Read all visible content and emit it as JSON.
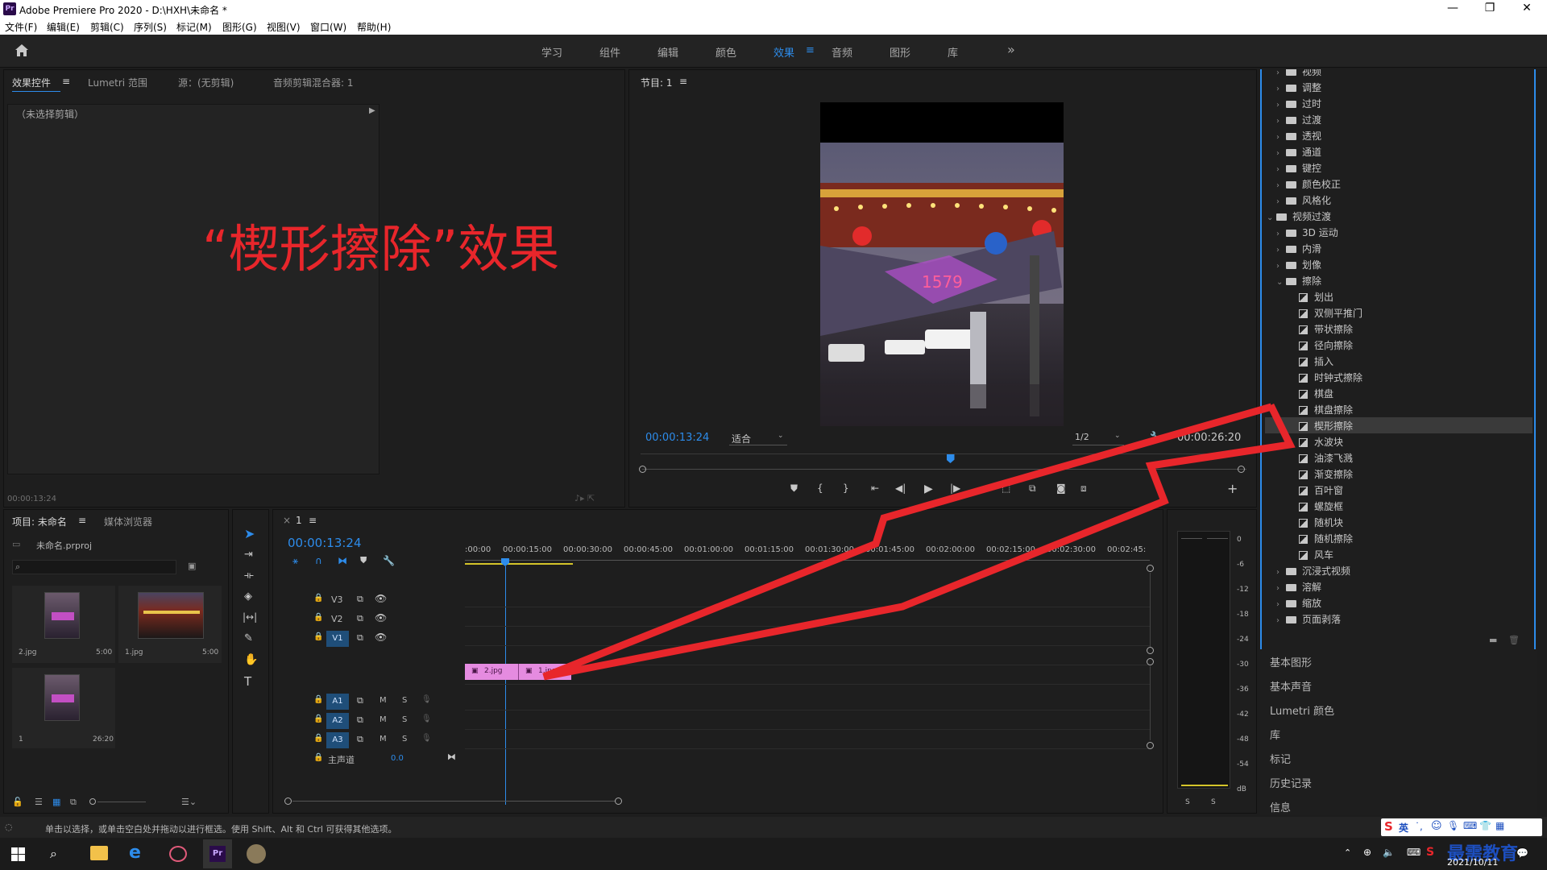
{
  "window": {
    "title": "Adobe Premiere Pro 2020 - D:\\HXH\\未命名 *",
    "logo_text": "Pr",
    "minimize": "—",
    "restore": "❐",
    "close": "✕"
  },
  "menu": [
    "文件(F)",
    "编辑(E)",
    "剪辑(C)",
    "序列(S)",
    "标记(M)",
    "图形(G)",
    "视图(V)",
    "窗口(W)",
    "帮助(H)"
  ],
  "workspaces": [
    "学习",
    "组件",
    "编辑",
    "颜色",
    "效果",
    "音频",
    "图形",
    "库"
  ],
  "workspace_active": "效果",
  "workspace_more": "»",
  "source_panel": {
    "tabs": [
      "效果控件",
      "Lumetri 范围",
      "源：(无剪辑)",
      "音频剪辑混合器: 1"
    ],
    "menu_icon": "≡",
    "no_clip": "（未选择剪辑）",
    "timecode": "00:00:13:24"
  },
  "annotation": "“楔形擦除”效果",
  "program": {
    "title": "节目: 1",
    "menu_icon": "≡",
    "timecode": "00:00:13:24",
    "fit": "适合",
    "resolution": "1/2",
    "duration": "00:00:26:20",
    "playhead_fraction": 0.51
  },
  "project": {
    "tabs": [
      "项目: 未命名",
      "媒体浏览器"
    ],
    "menu_icon": "≡",
    "file": "未命名.prproj",
    "items": [
      {
        "name": "2.jpg",
        "duration": "5:00"
      },
      {
        "name": "1.jpg",
        "duration": "5:00"
      },
      {
        "name": "1",
        "duration": "26:20"
      }
    ]
  },
  "timeline": {
    "tab": "1",
    "menu_icon": "≡",
    "timecode": "00:00:13:24",
    "ruler": [
      ":00:00",
      "00:00:15:00",
      "00:00:30:00",
      "00:00:45:00",
      "00:01:00:00",
      "00:01:15:00",
      "00:01:30:00",
      "00:01:45:00",
      "00:02:00:00",
      "00:02:15:00",
      "00:02:30:00",
      "00:02:45:"
    ],
    "video_tracks": [
      "V3",
      "V2",
      "V1"
    ],
    "audio_tracks": [
      "A1",
      "A2",
      "A3"
    ],
    "audio_btns": [
      "M",
      "S"
    ],
    "master_label": "主声道",
    "master_value": "0.0",
    "clips": [
      {
        "name": "2.jpg"
      },
      {
        "name": "1.jpg"
      }
    ]
  },
  "meter": {
    "scale": [
      "0",
      "-6",
      "-12",
      "-18",
      "-24",
      "-30",
      "-36",
      "-42",
      "-48",
      "-54",
      "dB"
    ],
    "solo": [
      "S",
      "S"
    ]
  },
  "effects_tree": {
    "top_folders": [
      "视频",
      "调整",
      "过时",
      "过渡",
      "透视",
      "通道",
      "键控",
      "颜色校正",
      "风格化"
    ],
    "open_group": "视频过渡",
    "transitions": [
      "3D 运动",
      "内滑",
      "划像"
    ],
    "wipe_folder": "擦除",
    "wipe_items": [
      "划出",
      "双侧平推门",
      "带状擦除",
      "径向擦除",
      "插入",
      "时钟式擦除",
      "棋盘",
      "棋盘擦除",
      "楔形擦除",
      "水波块",
      "油漆飞溅",
      "渐变擦除",
      "百叶窗",
      "螺旋框",
      "随机块",
      "随机擦除",
      "风车"
    ],
    "selected": "楔形擦除",
    "after_folders": [
      "沉浸式视频",
      "溶解",
      "缩放",
      "页面剥落"
    ]
  },
  "side_panels": [
    "基本图形",
    "基本声音",
    "Lumetri 颜色",
    "库",
    "标记",
    "历史记录",
    "信息"
  ],
  "status_bar": "单击以选择，或单击空白处并拖动以进行框选。使用 Shift、Alt 和 Ctrl 可获得其他选项。",
  "tray": {
    "ime": "英",
    "brand": "最需教育",
    "date": "2021/10/11"
  },
  "colors": {
    "accent_blue": "#2d8ceb",
    "annotation_red": "#e8262b",
    "clip_pink": "#e58be0",
    "selected_row": "#3a3a3a"
  }
}
